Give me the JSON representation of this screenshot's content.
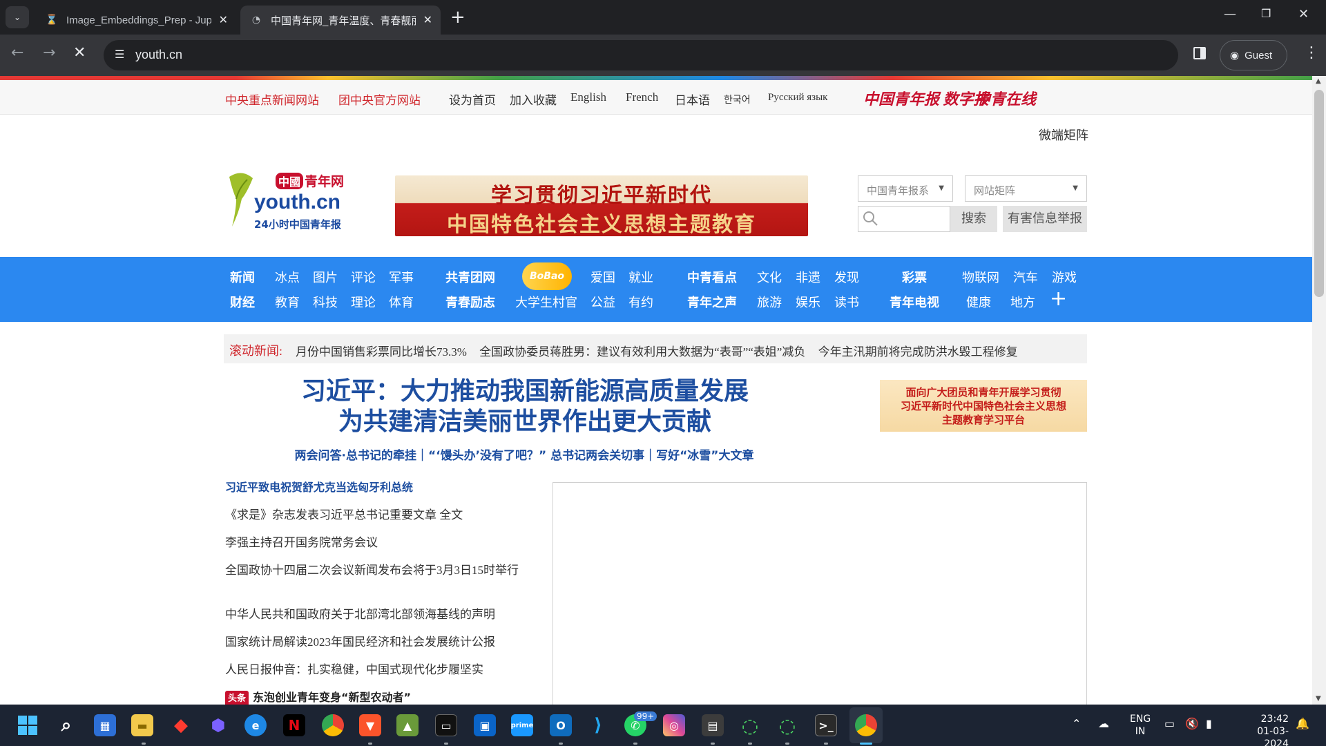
{
  "browser": {
    "tabs": [
      {
        "title": "Image_Embeddings_Prep - Jupyter",
        "icon": "hourglass-icon",
        "active": false
      },
      {
        "title": "中国青年网_青年温度、青春靓丽",
        "icon": "loading-globe-icon",
        "active": true
      }
    ],
    "url": "youth.cn",
    "profile_label": "Guest"
  },
  "page": {
    "top_links": {
      "left": [
        "中央重点新闻网站",
        "团中央官方网站"
      ],
      "middle": [
        "设为首页",
        "加入收藏",
        "English",
        "French",
        "日本语",
        "한국어",
        "Русский язык"
      ],
      "brands": [
        "中国青年报 数字报",
        "中青在线"
      ]
    },
    "matrix_link": "微端矩阵",
    "logo": {
      "cn": "青年网",
      "cn_badge": "中國",
      "en": "youth.cn",
      "sub": "24小时中国青年报"
    },
    "banner": {
      "line1": "学习贯彻习近平新时代",
      "line2": "中国特色社会主义思想主题教育"
    },
    "search": {
      "select1": "中国青年报系",
      "select2": "网站矩阵",
      "button": "搜索",
      "report": "有害信息举报"
    },
    "nav": {
      "group1_row1": [
        "新闻",
        "冰点",
        "图片",
        "评论",
        "军事"
      ],
      "group1_row2": [
        "财经",
        "教育",
        "科技",
        "理论",
        "体育"
      ],
      "group2_row1": [
        "共青团网"
      ],
      "group2_row2": [
        "青春励志",
        "大学生村官"
      ],
      "bobao": "BoBao",
      "group3_row1": [
        "爱国",
        "就业"
      ],
      "group3_row2": [
        "公益",
        "有约"
      ],
      "group4_row1": [
        "中青看点",
        "文化",
        "非遗",
        "发现"
      ],
      "group4_row2": [
        "青年之声",
        "旅游",
        "娱乐",
        "读书"
      ],
      "group5_row1": [
        "彩票",
        "物联网",
        "汽车",
        "游戏"
      ],
      "group5_row2": [
        "青年电视",
        "健康",
        "地方"
      ],
      "more": "+"
    },
    "ticker": {
      "label": "滚动新闻:",
      "items": [
        "月份中国销售彩票同比增长73.3%",
        "全国政协委员蒋胜男：建议有效利用大数据为“表哥”“表姐”减负",
        "今年主汛期前将完成防洪水毁工程修复"
      ]
    },
    "headline": {
      "line1": "习近平：大力推动我国新能源高质量发展",
      "line2": "为共建清洁美丽世界作出更大贡献",
      "sub": "两会问答·总书记的牵挂｜“‘馒头办’没有了吧？” 总书记两会关切事｜写好“冰雪”大文章"
    },
    "side_promo": {
      "l1": "面向广大团员和青年开展学习贯彻",
      "l2": "习近平新时代中国特色社会主义思想",
      "l3": "主题教育学习平台"
    },
    "news": [
      "习近平致电祝贺舒尤克当选匈牙利总统",
      "《求是》杂志发表习近平总书记重要文章  全文",
      "李强主持召开国务院常务会议",
      "全国政协十四届二次会议新闻发布会将于3月3日15时举行",
      "中华人民共和国政府关于北部湾北部领海基线的声明",
      "国家统计局解读2023年国民经济和社会发展统计公报",
      "人民日报仲音：扎实稳健，中国式现代化步履坚实"
    ],
    "toutiao_label": "头条",
    "toutiao_text": "东泡创业青年变身“新型农动者”"
  },
  "taskbar": {
    "badge": "99+",
    "lang_line1": "ENG",
    "lang_line2": "IN",
    "time": "23:42",
    "date": "01-03-2024"
  }
}
